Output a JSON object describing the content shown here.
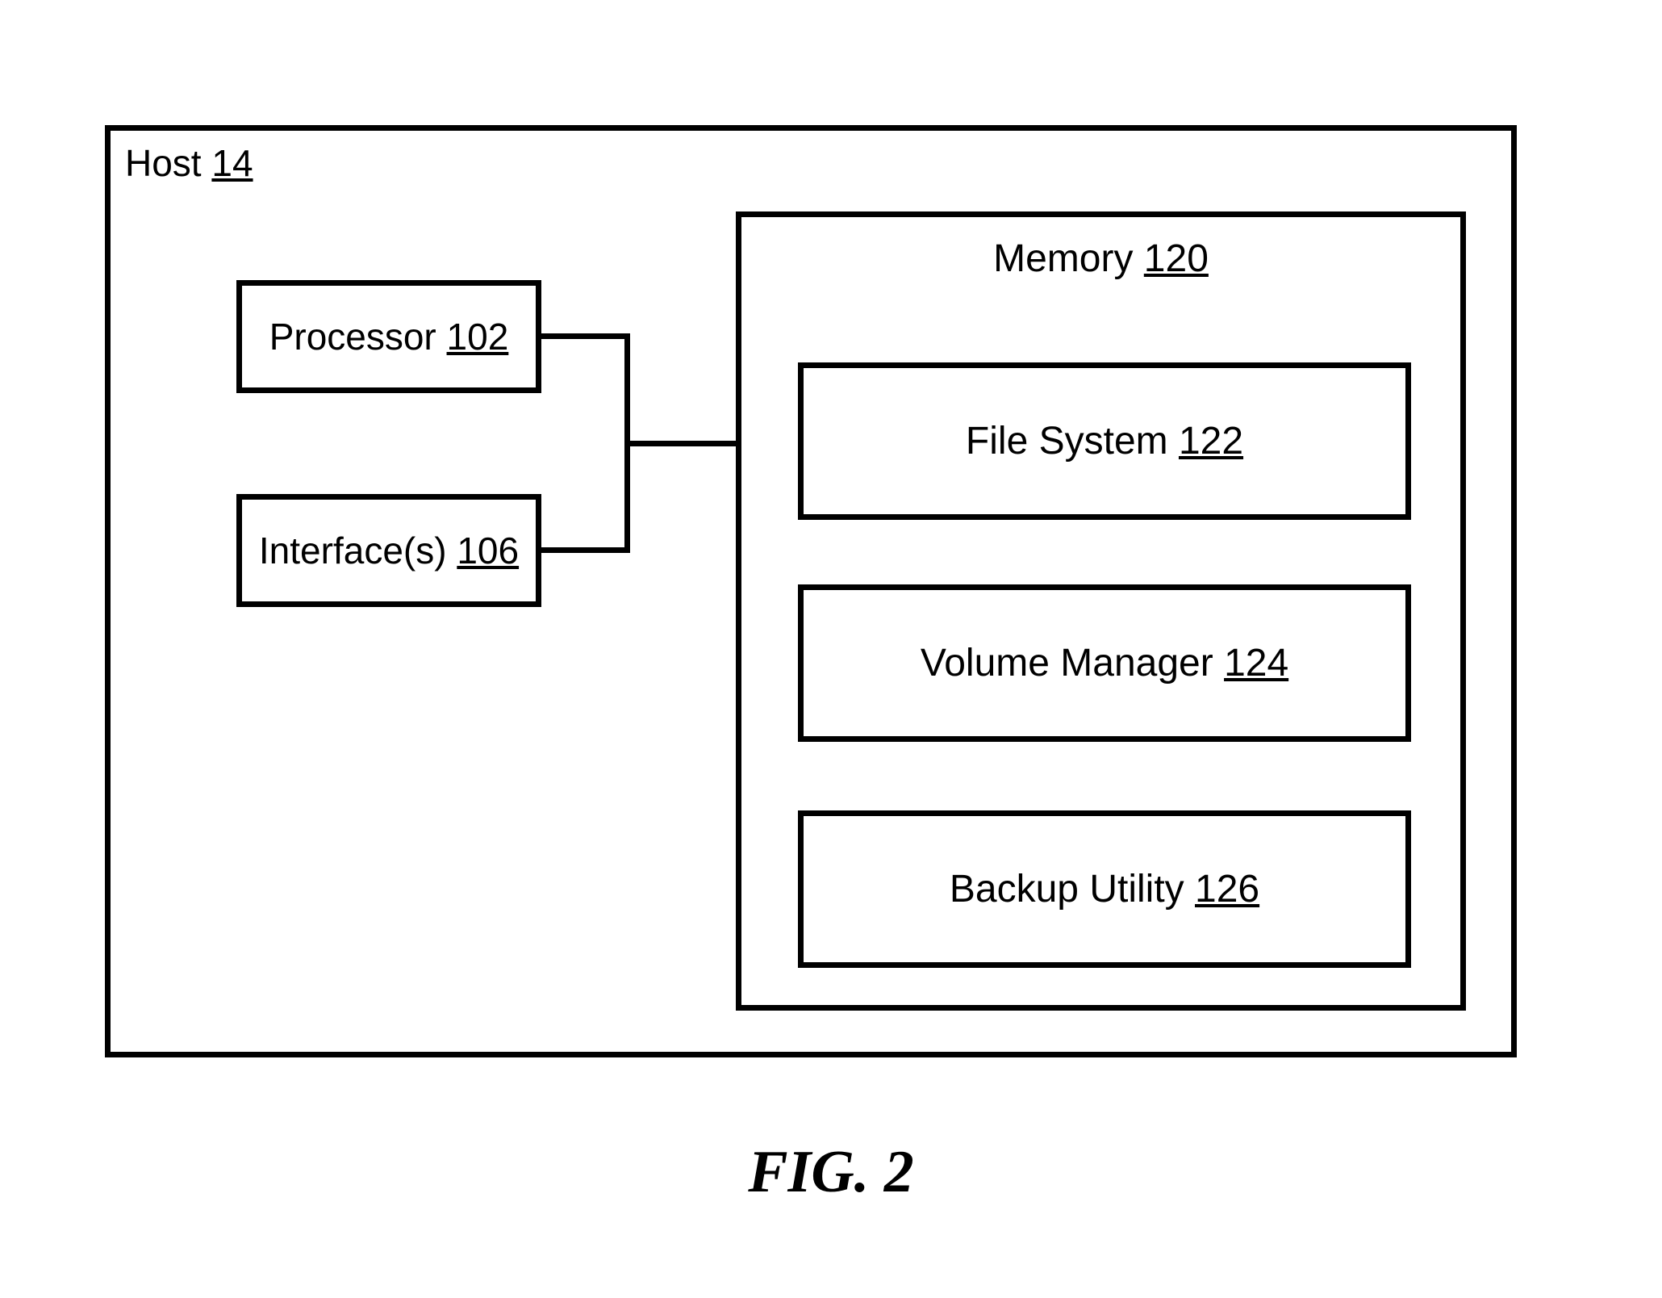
{
  "diagram": {
    "outer": {
      "label": "Host ",
      "ref": "14"
    },
    "processor": {
      "label": "Processor ",
      "ref": "102"
    },
    "interfaces": {
      "label": "Interface(s) ",
      "ref": "106"
    },
    "memory": {
      "label": "Memory ",
      "ref": "120",
      "file_system": {
        "label": "File System ",
        "ref": "122"
      },
      "volume_manager": {
        "label": "Volume Manager ",
        "ref": "124"
      },
      "backup_utility": {
        "label": "Backup Utility ",
        "ref": "126"
      }
    }
  },
  "caption": "FIG. 2"
}
